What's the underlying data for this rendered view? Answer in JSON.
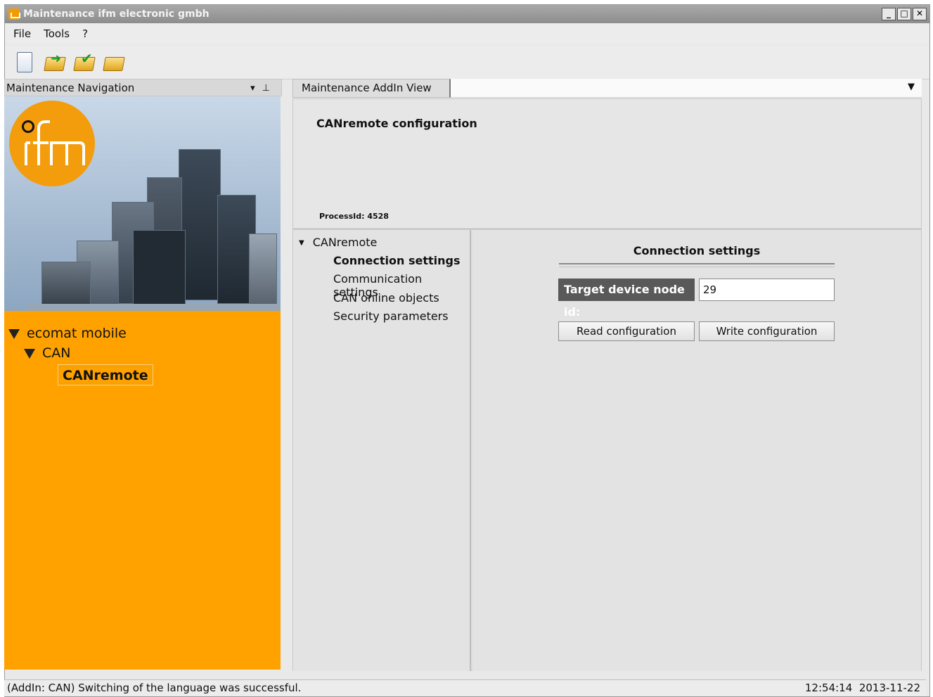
{
  "window": {
    "title": "Maintenance ifm electronic gmbh",
    "controls": [
      "minimize",
      "maximize",
      "close"
    ]
  },
  "menu": {
    "items": [
      "File",
      "Tools",
      "?"
    ]
  },
  "toolbar": {
    "icons": [
      "new-document-icon",
      "open-folder-icon",
      "save-folder-icon",
      "folder-icon"
    ]
  },
  "navigation": {
    "header": "Maintenance Navigation",
    "tree": {
      "root": "ecomat mobile",
      "child": "CAN",
      "selected": "CANremote"
    }
  },
  "tabs": {
    "active": "Maintenance AddIn View"
  },
  "addin": {
    "title": "CANremote configuration",
    "process_id": "ProcessId: 4528",
    "subnav": {
      "root": "CANremote",
      "items": [
        "Connection settings",
        "Communication settings",
        "CAN online objects",
        "Security parameters"
      ],
      "selected_index": 0
    },
    "connection": {
      "title": "Connection settings",
      "node_label": "Target device node id:",
      "node_value": "29",
      "read_button": "Read configuration",
      "write_button": "Write configuration"
    }
  },
  "status": {
    "message": "(AddIn: CAN) Switching of the language was successful.",
    "time": "12:54:14",
    "date": "2013-11-22"
  },
  "colors": {
    "accent": "#ffa200",
    "label_bg": "#595959"
  }
}
